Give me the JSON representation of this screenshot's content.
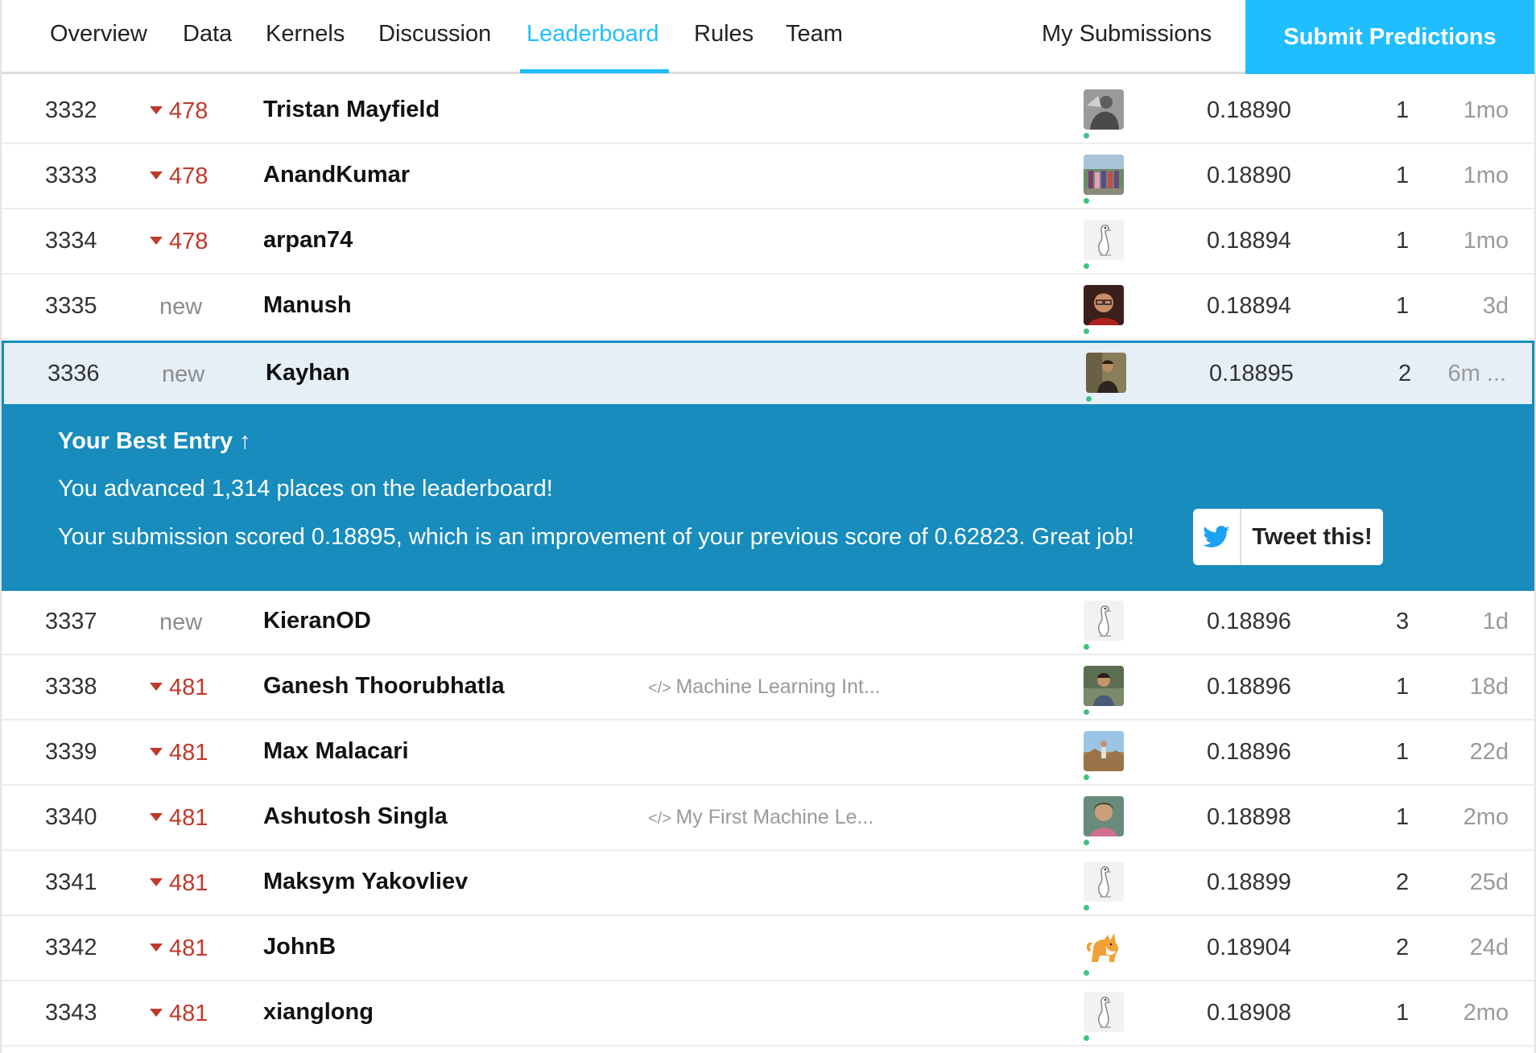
{
  "nav": {
    "tabs": [
      {
        "label": "Overview"
      },
      {
        "label": "Data"
      },
      {
        "label": "Kernels"
      },
      {
        "label": "Discussion"
      },
      {
        "label": "Leaderboard"
      },
      {
        "label": "Rules"
      },
      {
        "label": "Team"
      }
    ],
    "active_tab": "Leaderboard",
    "my_submissions": "My Submissions",
    "submit_predictions": "Submit Predictions"
  },
  "colors": {
    "accent": "#20beff",
    "best_entry_bg": "#178cbd",
    "rank_drop": "#c0392b",
    "highlight_row_bg": "#e6eff6"
  },
  "rows_before": [
    {
      "rank": "3332",
      "change": "478",
      "change_type": "down",
      "name": "Tristan Mayfield",
      "kernel": "",
      "score": "0.18890",
      "entries": "1",
      "last": "1mo",
      "avatar": "photo-gray"
    },
    {
      "rank": "3333",
      "change": "478",
      "change_type": "down",
      "name": "AnandKumar",
      "kernel": "",
      "score": "0.18890",
      "entries": "1",
      "last": "1mo",
      "avatar": "photo-group"
    },
    {
      "rank": "3334",
      "change": "478",
      "change_type": "down",
      "name": "arpan74",
      "kernel": "",
      "score": "0.18894",
      "entries": "1",
      "last": "1mo",
      "avatar": "goose"
    },
    {
      "rank": "3335",
      "change": "new",
      "change_type": "new",
      "name": "Manush",
      "kernel": "",
      "score": "0.18894",
      "entries": "1",
      "last": "3d",
      "avatar": "photo-face"
    }
  ],
  "highlight_row": {
    "rank": "3336",
    "change": "new",
    "change_type": "new",
    "name": "Kayhan",
    "kernel": "",
    "score": "0.18895",
    "entries": "2",
    "last": "6m ...",
    "avatar": "photo-person"
  },
  "best_entry": {
    "title": "Your Best Entry",
    "line1": "You advanced 1,314 places on the leaderboard!",
    "line2": "Your submission scored 0.18895, which is an improvement of your previous score of 0.62823. Great job!",
    "tweet_label": "Tweet this!"
  },
  "rows_after": [
    {
      "rank": "3337",
      "change": "new",
      "change_type": "new",
      "name": "KieranOD",
      "kernel": "",
      "score": "0.18896",
      "entries": "3",
      "last": "1d",
      "avatar": "goose"
    },
    {
      "rank": "3338",
      "change": "481",
      "change_type": "down",
      "name": "Ganesh Thoorubhatla",
      "kernel": "Machine Learning Int...",
      "score": "0.18896",
      "entries": "1",
      "last": "18d",
      "avatar": "photo-person2"
    },
    {
      "rank": "3339",
      "change": "481",
      "change_type": "down",
      "name": "Max Malacari",
      "kernel": "",
      "score": "0.18896",
      "entries": "1",
      "last": "22d",
      "avatar": "photo-outdoor"
    },
    {
      "rank": "3340",
      "change": "481",
      "change_type": "down",
      "name": "Ashutosh Singla",
      "kernel": "My First Machine Le...",
      "score": "0.18898",
      "entries": "1",
      "last": "2mo",
      "avatar": "photo-face2"
    },
    {
      "rank": "3341",
      "change": "481",
      "change_type": "down",
      "name": "Maksym Yakovliev",
      "kernel": "",
      "score": "0.18899",
      "entries": "2",
      "last": "25d",
      "avatar": "goose"
    },
    {
      "rank": "3342",
      "change": "481",
      "change_type": "down",
      "name": "JohnB",
      "kernel": "",
      "score": "0.18904",
      "entries": "2",
      "last": "24d",
      "avatar": "shiba"
    },
    {
      "rank": "3343",
      "change": "481",
      "change_type": "down",
      "name": "xianglong",
      "kernel": "",
      "score": "0.18908",
      "entries": "1",
      "last": "2mo",
      "avatar": "goose"
    }
  ]
}
